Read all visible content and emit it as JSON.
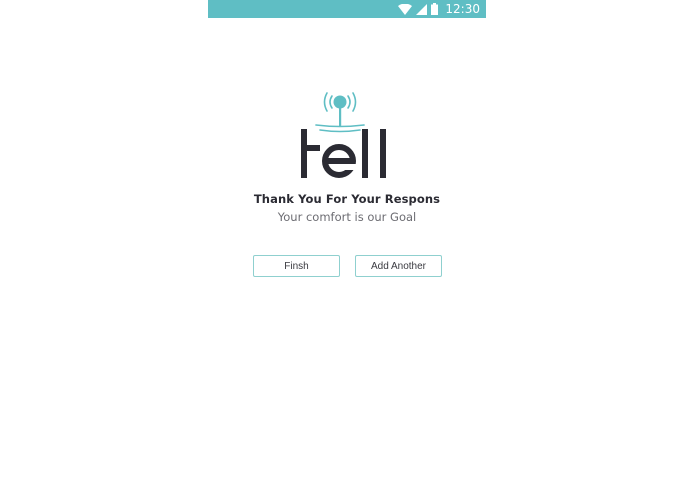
{
  "status_bar": {
    "time": "12:30",
    "background_color": "#5fbec4",
    "icons": [
      "wifi-icon",
      "signal-icon",
      "battery-icon"
    ]
  },
  "logo": {
    "text": "tell",
    "accent_color": "#5fbec4",
    "text_color": "#2b2b33"
  },
  "message": {
    "title": "Thank You For Your Respons",
    "subtitle": "Your comfort is our Goal"
  },
  "actions": {
    "finish_label": "Finsh",
    "add_another_label": "Add Another",
    "border_color": "#8fd0cf"
  }
}
